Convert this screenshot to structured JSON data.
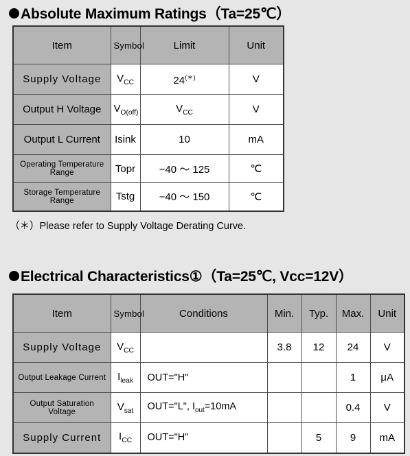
{
  "sections": {
    "ratings": {
      "title": "Absolute Maximum Ratings（Ta=25℃）",
      "footnote": "（＊）Please refer to Supply Voltage Derating Curve.",
      "headers": [
        "Item",
        "Symbol",
        "Limit",
        "Unit"
      ],
      "rows": [
        {
          "item": "Supply  Voltage",
          "symbol_base": "V",
          "symbol_sub": "CC",
          "limit_base": "24",
          "limit_sup": "(＊)",
          "limit_sub": "",
          "unit": "V",
          "item_style": "wide"
        },
        {
          "item": "Output H Voltage",
          "symbol_base": "V",
          "symbol_sub": "O(off)",
          "limit_base": "V",
          "limit_sup": "",
          "limit_sub": "CC",
          "unit": "V",
          "item_style": "normal"
        },
        {
          "item": "Output  L  Current",
          "symbol_base": "Isink",
          "symbol_sub": "",
          "limit_base": "10",
          "limit_sup": "",
          "limit_sub": "",
          "unit": "mA",
          "item_style": "normal"
        },
        {
          "item": "Operating  Temperature  Range",
          "symbol_base": "Topr",
          "symbol_sub": "",
          "limit_base": "−40 ～ 125",
          "limit_sup": "",
          "limit_sub": "",
          "unit": "℃",
          "item_style": "condensed"
        },
        {
          "item": "Storage Temperature Range",
          "symbol_base": "Tstg",
          "symbol_sub": "",
          "limit_base": "−40 ～ 150",
          "limit_sup": "",
          "limit_sub": "",
          "unit": "℃",
          "item_style": "condensed"
        }
      ]
    },
    "electrical": {
      "title": "Electrical Characteristics①（Ta=25℃, Vcc=12V）",
      "headers": [
        "Item",
        "Symbol",
        "Conditions",
        "Min.",
        "Typ.",
        "Max.",
        "Unit"
      ],
      "rows": [
        {
          "item": "Supply  Voltage",
          "symbol_base": "V",
          "symbol_sub": "CC",
          "conditions": "",
          "min": "3.8",
          "typ": "12",
          "max": "24",
          "unit": "V",
          "item_style": "wide"
        },
        {
          "item": "Output Leakage Current",
          "symbol_base": "I",
          "symbol_sub": "leak",
          "conditions": "OUT=\"H\"",
          "min": "",
          "typ": "",
          "max": "1",
          "unit": "μA",
          "item_style": "condensed"
        },
        {
          "item": "Output  Saturation  Voltage",
          "symbol_base": "V",
          "symbol_sub": "sat",
          "conditions": "OUT=\"L\",  I|out|=10mA",
          "min": "",
          "typ": "",
          "max": "0.4",
          "unit": "V",
          "item_style": "condensed"
        },
        {
          "item": "Supply   Current",
          "symbol_base": "I",
          "symbol_sub": "CC",
          "conditions": "OUT=\"H\"",
          "min": "",
          "typ": "5",
          "max": "9",
          "unit": "mA",
          "item_style": "wide"
        }
      ]
    }
  },
  "colors": {
    "page_background": "#e6e6e6",
    "header_gray": "#b4b4b4",
    "cell_white": "#ffffff",
    "border": "#4d4d4d",
    "text": "#000000"
  }
}
